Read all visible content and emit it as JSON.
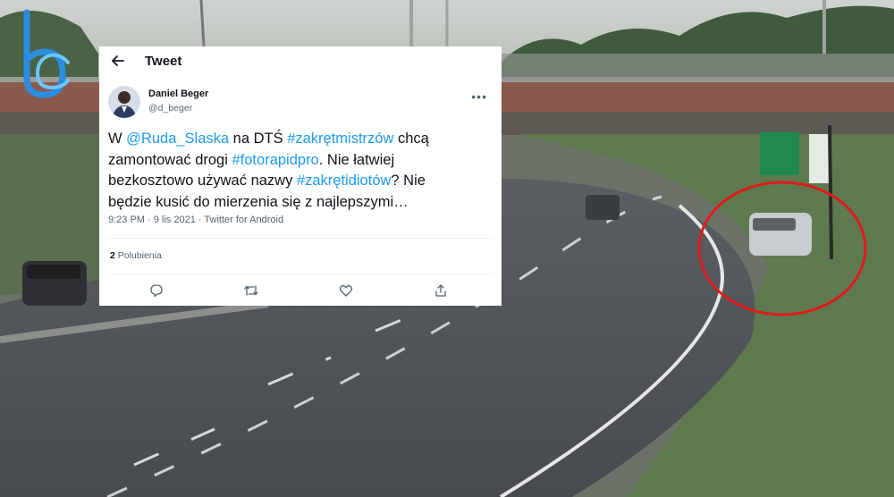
{
  "tweet": {
    "header_title": "Tweet",
    "author_name": "Daniel Beger",
    "author_handle": "@d_beger",
    "more": "•••",
    "text_parts": [
      "W ",
      "@Ruda_Slaska",
      " na DTŚ ",
      "#zakrętmistrzów",
      " chcą zamontować drogi ",
      "#fotorapidpro",
      ". Nie łatwiej bezkosztowo używać nazwy ",
      "#zakrętidiotów",
      "? Nie będzie kusić do mierzenia się z najlepszymi…"
    ],
    "timestamp": "9:23 PM · 9 lis 2021 · Twitter for Android",
    "likes_count": "2",
    "likes_label": " Polubienia"
  },
  "colors": {
    "accent": "#1d9bf0",
    "circle": "#e01b1b",
    "logo": "#2a8de0"
  },
  "icons": [
    "back-arrow-icon",
    "more-icon",
    "reply-icon",
    "retweet-icon",
    "like-icon",
    "share-icon",
    "logo-icon"
  ]
}
